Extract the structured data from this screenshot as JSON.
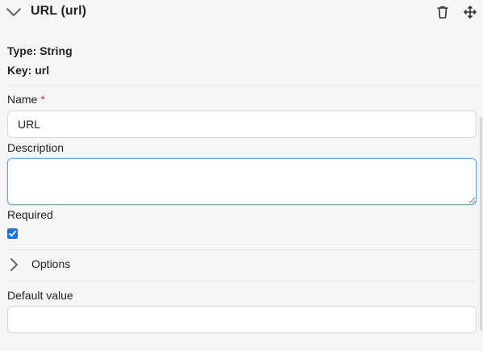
{
  "header": {
    "title": "URL (url)",
    "collapse_icon": "chevron-down-icon",
    "delete_icon": "trash-icon",
    "move_icon": "move-icon"
  },
  "meta": {
    "type_text": "Type: String",
    "key_text": "Key: url"
  },
  "fields": {
    "name": {
      "label": "Name",
      "required_marker": "*",
      "value": "URL"
    },
    "description": {
      "label": "Description",
      "value": ""
    },
    "required": {
      "label": "Required",
      "checked": true
    },
    "options": {
      "label": "Options",
      "icon": "chevron-right-icon"
    },
    "default_value": {
      "label": "Default value",
      "value": ""
    }
  },
  "colors": {
    "background": "#f6f6f6",
    "required_star": "#d93025",
    "focus_border": "#6ea8e8",
    "checkbox": "#1a73e8"
  }
}
